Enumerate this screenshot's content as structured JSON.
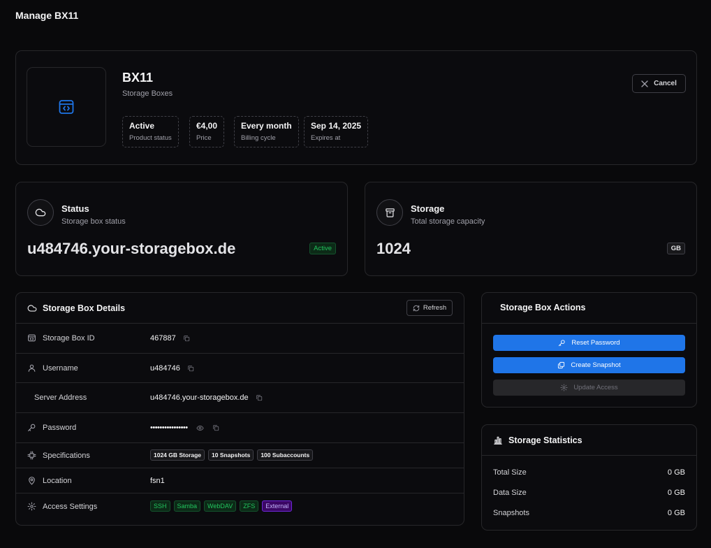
{
  "page": {
    "title": "Manage BX11"
  },
  "product": {
    "name": "BX11",
    "category": "Storage Boxes",
    "chips": [
      {
        "value": "Active",
        "label": "Product status"
      },
      {
        "value": "€4,00",
        "label": "Price"
      },
      {
        "value": "Every month",
        "label": "Billing cycle"
      },
      {
        "value": "Sep 14, 2025",
        "label": "Expires at"
      }
    ],
    "cancel_label": "Cancel",
    "accent_color": "#1f75e8"
  },
  "status_card": {
    "title": "Status",
    "subtitle": "Storage box status",
    "value": "u484746.your-storagebox.de",
    "badge": "Active",
    "icon": "cloud-icon"
  },
  "storage_card": {
    "title": "Storage",
    "subtitle": "Total storage capacity",
    "value": "1024",
    "unit": "GB",
    "icon": "archive-icon"
  },
  "details": {
    "title": "Storage Box Details",
    "refresh_label": "Refresh",
    "rows": {
      "id": {
        "label": "Storage Box ID",
        "value": "467887",
        "icon": "id-icon"
      },
      "username": {
        "label": "Username",
        "value": "u484746",
        "icon": "user-icon"
      },
      "server": {
        "label": "Server Address",
        "value": "u484746.your-storagebox.de"
      },
      "password": {
        "label": "Password",
        "value": "••••••••••••••••",
        "icon": "key-icon"
      },
      "specs": {
        "label": "Specifications",
        "tags": [
          "1024 GB Storage",
          "10 Snapshots",
          "100 Subaccounts"
        ],
        "icon": "cpu-icon"
      },
      "location": {
        "label": "Location",
        "value": "fsn1",
        "icon": "map-pin-icon"
      },
      "access": {
        "label": "Access Settings",
        "tags": [
          "SSH",
          "Samba",
          "WebDAV",
          "ZFS",
          "External"
        ],
        "icon": "gear-icon"
      }
    }
  },
  "actions": {
    "title": "Storage Box Actions",
    "reset_password": "Reset Password",
    "create_snapshot": "Create Snapshot",
    "update_access": "Update Access"
  },
  "stats": {
    "title": "Storage Statistics",
    "rows": [
      {
        "label": "Total Size",
        "value": "0 GB"
      },
      {
        "label": "Data Size",
        "value": "0 GB"
      },
      {
        "label": "Snapshots",
        "value": "0 GB"
      }
    ]
  }
}
